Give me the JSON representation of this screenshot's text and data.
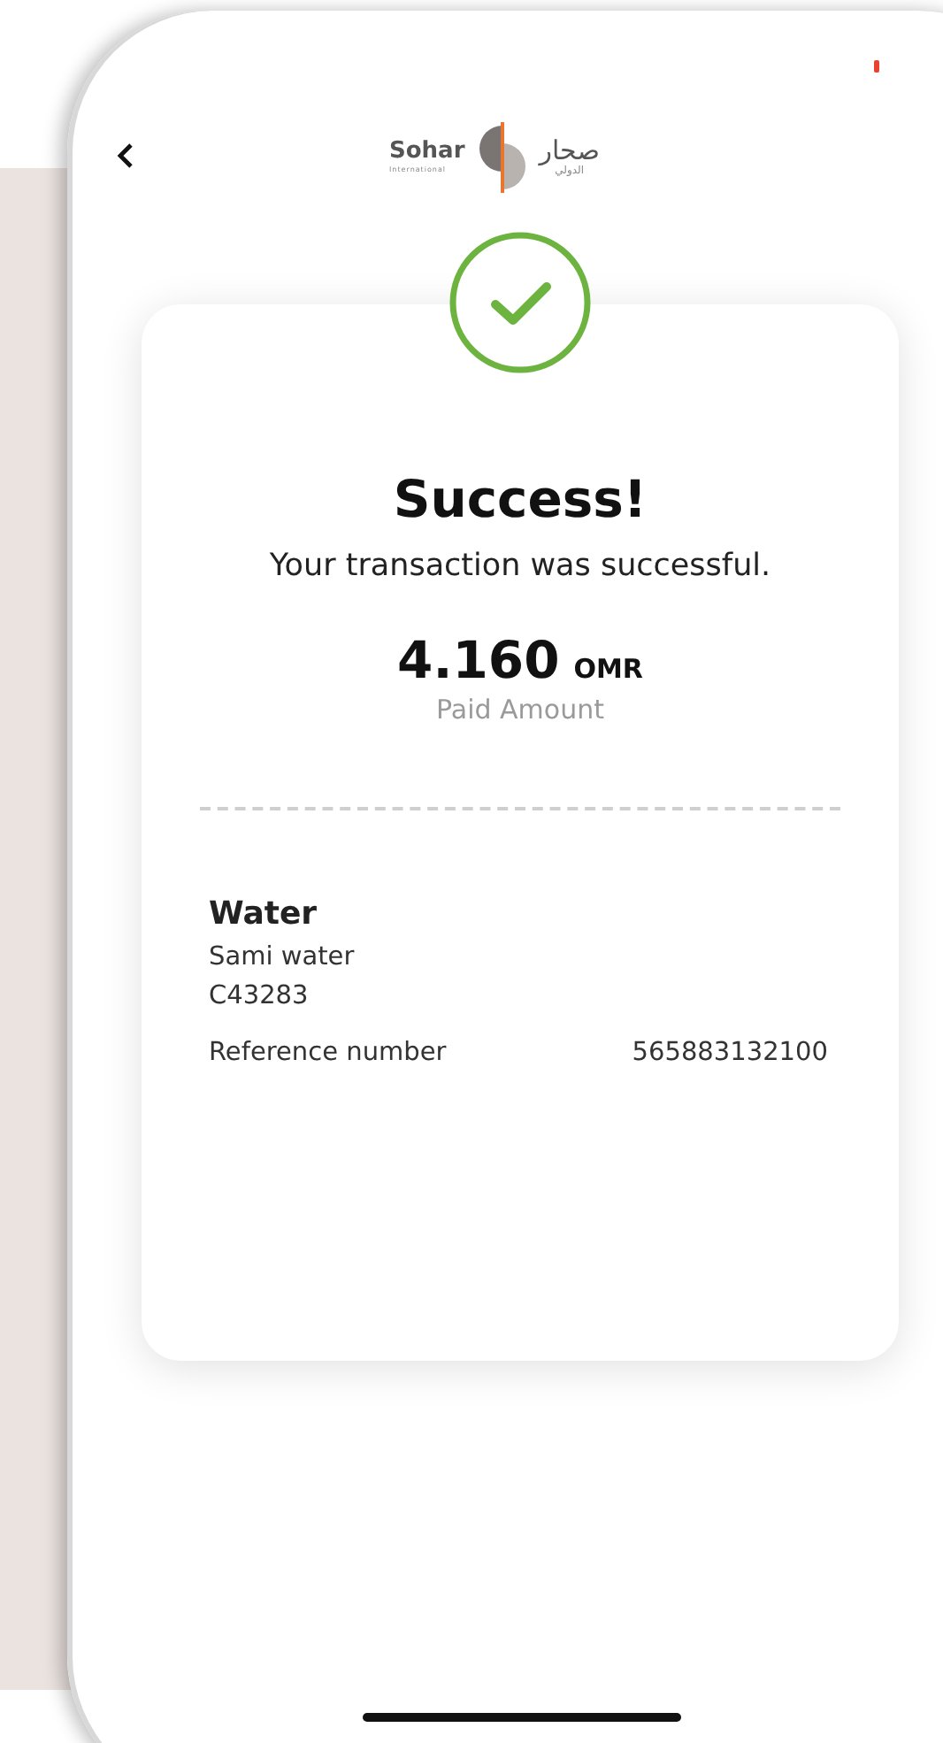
{
  "header": {
    "logo": {
      "name": "Sohar",
      "subtitle": "International",
      "arabic_name": "صحار",
      "arabic_subtitle": "الدولي"
    }
  },
  "result": {
    "title": "Success!",
    "message": "Your transaction was successful.",
    "amount": "4.160",
    "currency": "OMR",
    "amount_label": "Paid Amount"
  },
  "details": {
    "category": "Water",
    "biller": "Sami water",
    "account": "C43283",
    "reference_label": "Reference number",
    "reference_value": "565883132100"
  }
}
